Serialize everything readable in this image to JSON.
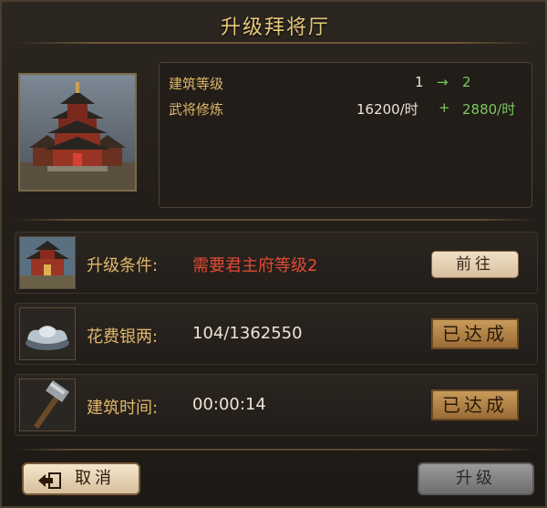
{
  "header": {
    "title": "升级拜将厅"
  },
  "stats": [
    {
      "label": "建筑等级",
      "current": "1",
      "arrow": "→",
      "next": "2"
    },
    {
      "label": "武将修炼",
      "current": "16200/时",
      "arrow": "+",
      "next": "2880/时"
    }
  ],
  "requirements": [
    {
      "label": "升级条件:",
      "value": "需要君主府等级2",
      "action": "前往",
      "icon": "palace-icon"
    },
    {
      "label": "花费银两:",
      "value": "104/1362550",
      "status": "已达成",
      "icon": "silver-ingot-icon"
    },
    {
      "label": "建筑时间:",
      "value": "00:00:14",
      "status": "已达成",
      "icon": "hammer-icon"
    }
  ],
  "footer": {
    "cancel_label": "取消",
    "upgrade_label": "升级"
  },
  "colors": {
    "accent": "#e0b66a",
    "highlight": "#7cc860",
    "warning": "#e04a34"
  }
}
